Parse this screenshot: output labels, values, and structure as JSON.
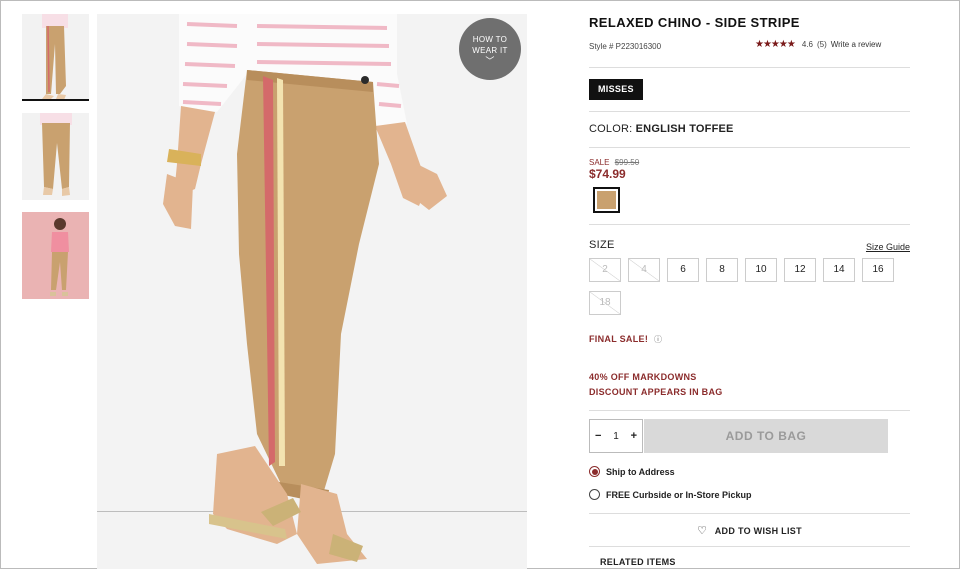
{
  "product": {
    "title": "RELAXED CHINO - SIDE STRIPE",
    "style": "Style # P223016300",
    "rating": {
      "stars_icon": "star-rating-icon",
      "stars_text": "★★★★★",
      "value": "4.6",
      "count": "(5)",
      "write_review": "Write a review"
    }
  },
  "fit_button": "MISSES",
  "color": {
    "label": "COLOR:",
    "value": "ENGLISH TOFFEE",
    "swatch_hex": "#c9a16f"
  },
  "pricing": {
    "sale_label": "SALE",
    "original": "$99.50",
    "current": "$74.99"
  },
  "size": {
    "label": "SIZE",
    "guide": "Size Guide",
    "options": [
      {
        "label": "2",
        "available": false
      },
      {
        "label": "4",
        "available": false
      },
      {
        "label": "6",
        "available": true
      },
      {
        "label": "8",
        "available": true
      },
      {
        "label": "10",
        "available": true
      },
      {
        "label": "12",
        "available": true
      },
      {
        "label": "14",
        "available": true
      },
      {
        "label": "16",
        "available": true
      },
      {
        "label": "18",
        "available": false
      }
    ]
  },
  "final_sale": "FINAL SALE!",
  "final_sale_info_icon": "info-icon",
  "final_sale_info_glyph": "ⓘ",
  "promo": {
    "line1": "40% OFF MARKDOWNS",
    "line2": "DISCOUNT APPEARS IN BAG"
  },
  "quantity": {
    "minus": "−",
    "value": "1",
    "plus": "+"
  },
  "add_to_bag": "ADD TO BAG",
  "shipping": {
    "ship_to_address": "Ship to Address",
    "pickup": "FREE Curbside or In-Store Pickup",
    "selected": "ship_to_address"
  },
  "wish_list": {
    "heart_glyph": "♡",
    "label": "ADD TO WISH LIST"
  },
  "related": "RELATED ITEMS",
  "how_to_wear": {
    "line1": "HOW TO",
    "line2": "WEAR IT",
    "chevron": "﹀"
  },
  "colors": {
    "accent": "#8b2c2c",
    "star": "#7a1a1a",
    "pant": "#c9a16f",
    "stripe_red": "#d46a6a",
    "stripe_cream": "#f3e3b0"
  }
}
